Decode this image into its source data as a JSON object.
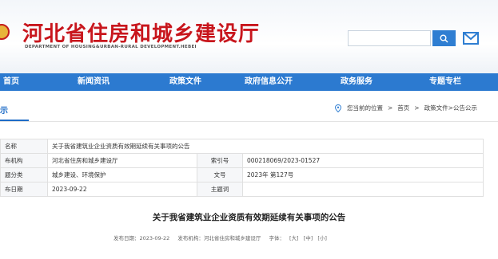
{
  "header": {
    "title": "河北省住房和城乡建设厅",
    "subtitle": "DEPARTMENT OF HOUSING&URBAN-RURAL DEVELOPMENT.HEBEI",
    "search_placeholder": "",
    "search_icon": "search-icon",
    "mail_icon": "mail-icon",
    "brand_color": "#c8161d",
    "accent_color": "#2c7ad0"
  },
  "nav": {
    "items": [
      "首页",
      "新闻资讯",
      "政策文件",
      "政府信息公开",
      "政务服务",
      "专题专栏"
    ]
  },
  "section": {
    "title": "示",
    "breadcrumb": {
      "prefix": "您当前的位置",
      "items": [
        "首页",
        "政策文件>公告公示"
      ],
      "separator": ">"
    }
  },
  "info_table": {
    "rows": [
      {
        "label": "名称",
        "value": "关于我省建筑业企业资质有效期延续有关事项的公告"
      },
      {
        "label": "布机构",
        "value": "河北省住房和城乡建设厅",
        "label2": "索引号",
        "value2": "000218069/2023-01527"
      },
      {
        "label": "题分类",
        "value": "城乡建设、环境保护",
        "label2": "文号",
        "value2": "2023年 第127号"
      },
      {
        "label": "布日期",
        "value": "2023-09-22",
        "label2": "主题词",
        "value2": ""
      }
    ]
  },
  "article": {
    "title": "关于我省建筑业企业资质有效期延续有关事项的公告",
    "meta": {
      "date": "发布日期：2023-09-22",
      "org": "发布机构：河北省住房和城乡建设厅",
      "font_label": "字体：",
      "font_options": [
        "[大]",
        "[中]",
        "[小]"
      ]
    }
  }
}
